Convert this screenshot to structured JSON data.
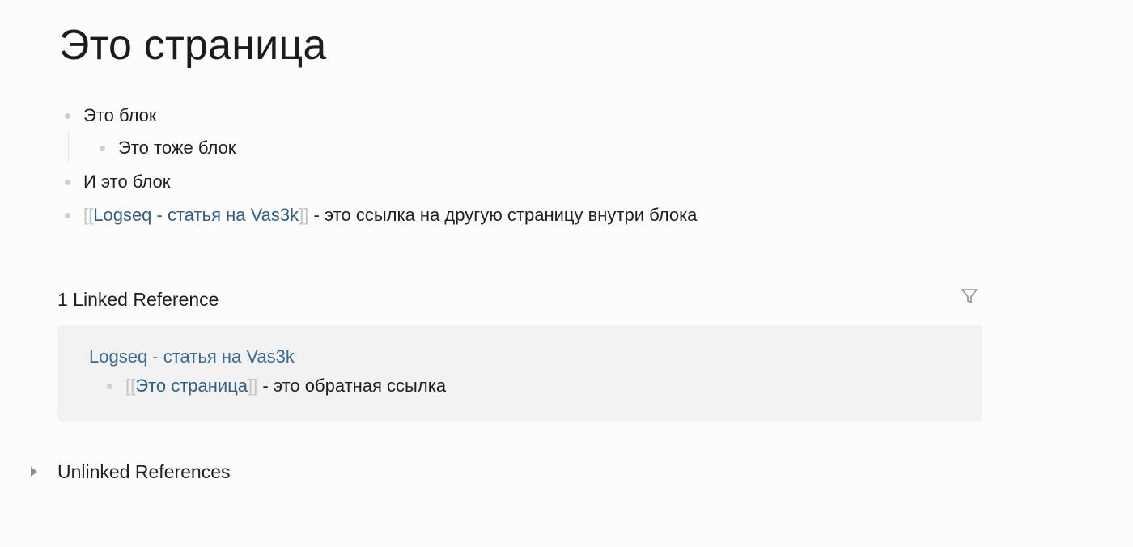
{
  "page": {
    "title": "Это страница"
  },
  "blocks": [
    {
      "text": "Это блок"
    },
    {
      "text": "Это тоже блок"
    },
    {
      "text": "И это блок"
    },
    {
      "bracket_open": "[[",
      "ref": "Logseq - статья на Vas3k",
      "bracket_close": "]]",
      "text": " - это ссылка на другую страницу внутри блока"
    }
  ],
  "linked_references": {
    "title": "1 Linked Reference",
    "filter_icon": "filter-icon",
    "items": [
      {
        "page": "Logseq - статья на Vas3k",
        "block": {
          "bracket_open": "[[",
          "ref": "Это страница",
          "bracket_close": "]]",
          "text": " - это обратная ссылка"
        }
      }
    ]
  },
  "unlinked_references": {
    "title": "Unlinked References",
    "toggle_icon": "caret-right-icon"
  },
  "colors": {
    "background": "#fcfcfc",
    "link": "#2f5f86",
    "bracket": "#c3c3c3",
    "bullet": "#cfcfcf",
    "card": "#f2f2f2"
  }
}
